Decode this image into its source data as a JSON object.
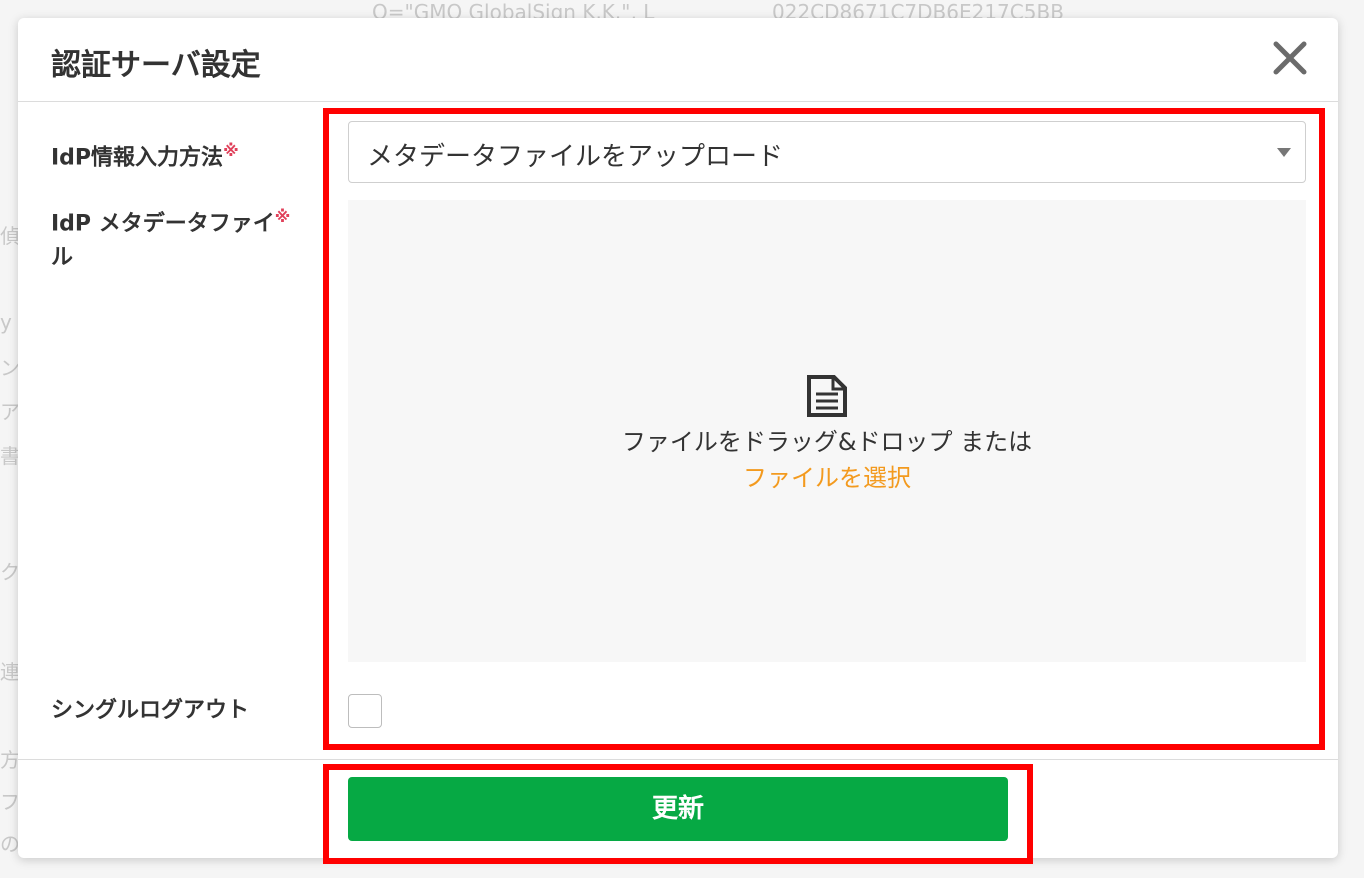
{
  "background": {
    "top_text": "O=\"GMO GlobalSign K.K.\", L",
    "top_code": "022CD8671C7DB6E217C5BB",
    "side_chars": [
      "偵",
      "y",
      "ン",
      "ア",
      "書",
      "ク",
      "連",
      "方",
      "フ",
      "の"
    ]
  },
  "modal": {
    "title": "認証サーバ設定",
    "close_icon": "close-icon"
  },
  "form": {
    "idp_input_method": {
      "label": "IdP情報入力方法",
      "required_mark": "※",
      "selected": "メタデータファイルをアップロード"
    },
    "idp_metadata_file": {
      "label_line1": "IdP メタデータファイ",
      "label_line2": "ル",
      "required_mark": "※",
      "drop_text": "ファイルをドラッグ&ドロップ または",
      "select_link": "ファイルを選択",
      "icon": "file-document-icon"
    },
    "single_logout": {
      "label": "シングルログアウト",
      "checked": false
    }
  },
  "footer": {
    "submit_label": "更新"
  },
  "colors": {
    "highlight": "#ff0000",
    "submit": "#06a944",
    "link": "#f39a1e",
    "required": "#e0405a"
  }
}
